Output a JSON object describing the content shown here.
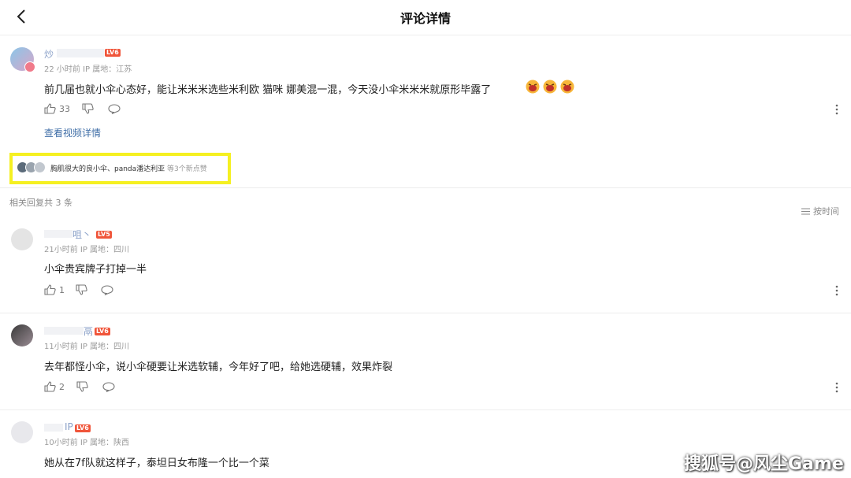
{
  "header": {
    "title": "评论详情"
  },
  "main_comment": {
    "username": "炒",
    "level": "LV6",
    "meta": "22 小时前  IP 属地：江苏",
    "content": "前几届也就小伞心态好，能让米米米选些米利欧 猫咪 娜美混一混，今天没小伞米米米就原形毕露了",
    "emoji_count": 3,
    "like_count": "33",
    "video_link": "查看视频详情",
    "likers_text": "胸肌很大的良小伞、panda潘达利亚",
    "likers_tail": "等3个新点赞"
  },
  "replies_section": {
    "title": "相关回复共 3 条",
    "sort_label": "按时间"
  },
  "replies": [
    {
      "username": "咀丶",
      "level": "LV5",
      "meta": "21小时前  IP 属地：四川",
      "content": "小伞贵宾牌子打掉一半",
      "like_count": "1"
    },
    {
      "username": "鬲",
      "level": "LV6",
      "meta": "11小时前  IP 属地：四川",
      "content": "去年都怪小伞，说小伞硬要让米选软辅，今年好了吧，给她选硬辅，效果炸裂",
      "like_count": "2"
    },
    {
      "username": "IP",
      "level": "LV6",
      "meta": "10小时前  IP 属地：陕西",
      "content": "她从在7f队就这样子，泰坦日女布隆一个比一个菜",
      "like_count": ""
    }
  ],
  "watermark": "搜狐号@风尘Game",
  "colors": {
    "highlight": "#f5f021",
    "level_badge": "#f0553a",
    "link": "#3f6ea7"
  }
}
